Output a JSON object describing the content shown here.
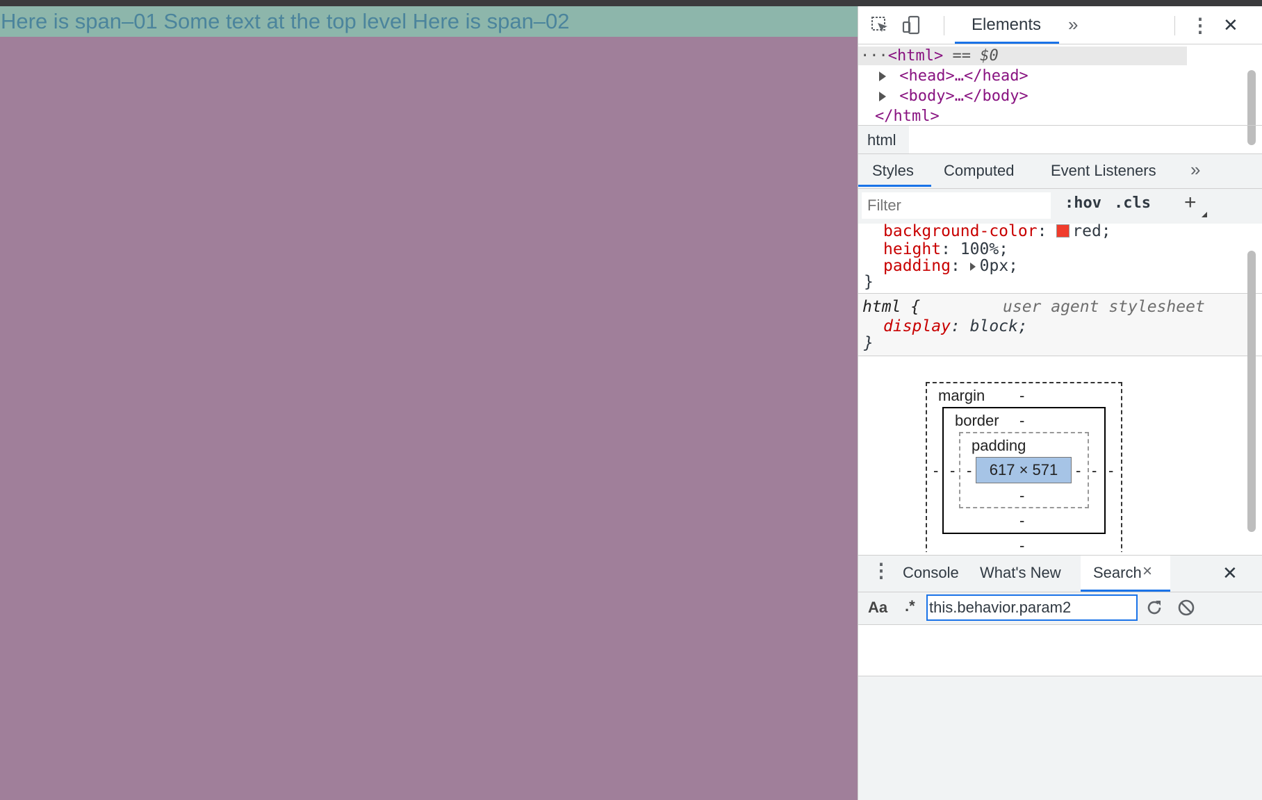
{
  "page": {
    "top_text": "Here is span–01 Some text at the top level Here is span–02",
    "colors": {
      "background": "#a07f9a",
      "bar": "#8db6ab",
      "text": "#4b849c"
    }
  },
  "devtools": {
    "toolbar": {
      "inspect_icon": "cursor-select-icon",
      "device_icon": "device-toggle-icon",
      "tab_elements": "Elements",
      "more": "»",
      "menu": "⋮",
      "close": "✕"
    },
    "dom_tree": {
      "ellipsis": "···",
      "html_open": "<html>",
      "selected_marker": " == $0",
      "head": "<head>…</head>",
      "body": "<body>…</body>",
      "html_close": "</html>"
    },
    "breadcrumb": "html",
    "styles_tabs": [
      "Styles",
      "Computed",
      "Event Listeners",
      "»"
    ],
    "filter": {
      "placeholder": "Filter",
      "hov": ":hov",
      "cls": ".cls",
      "add": "+"
    },
    "rules": {
      "line1_prop": "background-color",
      "line1_val": "red;",
      "line2_prop": "height",
      "line2_val": "100%;",
      "line3_prop": "padding",
      "line3_val": "0px;",
      "close_brace": "}",
      "ua_selector": "html {",
      "ua_source": "user agent stylesheet",
      "ua_prop": "display",
      "ua_val": "block;",
      "ua_close": "}"
    },
    "box_model": {
      "margin_label": "margin",
      "border_label": "border",
      "padding_label": "padding",
      "content": "617 × 571",
      "dash": "-"
    },
    "drawer": {
      "tabs": [
        "Console",
        "What's New",
        "Search"
      ],
      "search_close": "×",
      "close": "✕",
      "case_toggle": "Aa",
      "regex_toggle": ".*",
      "search_value": "this.behavior.param2"
    }
  }
}
